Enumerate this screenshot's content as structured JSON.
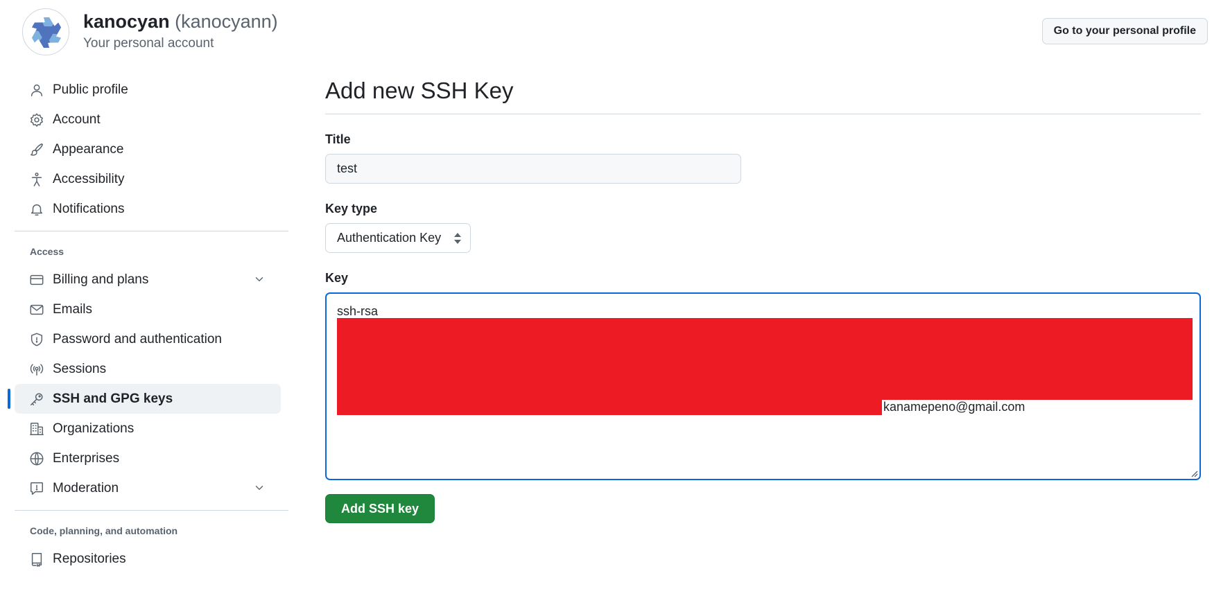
{
  "account": {
    "name": "kanocyan",
    "login": "(kanocyann)",
    "subtitle": "Your personal account",
    "profile_button": "Go to your personal profile"
  },
  "sidebar": {
    "top_items": [
      {
        "label": "Public profile",
        "icon": "person-icon"
      },
      {
        "label": "Account",
        "icon": "gear-icon"
      },
      {
        "label": "Appearance",
        "icon": "paintbrush-icon"
      },
      {
        "label": "Accessibility",
        "icon": "accessibility-icon"
      },
      {
        "label": "Notifications",
        "icon": "bell-icon"
      }
    ],
    "access_label": "Access",
    "access_items": [
      {
        "label": "Billing and plans",
        "icon": "credit-card-icon",
        "expandable": true
      },
      {
        "label": "Emails",
        "icon": "mail-icon"
      },
      {
        "label": "Password and authentication",
        "icon": "shield-icon"
      },
      {
        "label": "Sessions",
        "icon": "broadcast-icon"
      },
      {
        "label": "SSH and GPG keys",
        "icon": "key-icon",
        "active": true
      },
      {
        "label": "Organizations",
        "icon": "organization-icon"
      },
      {
        "label": "Enterprises",
        "icon": "globe-icon"
      },
      {
        "label": "Moderation",
        "icon": "report-icon",
        "expandable": true
      }
    ],
    "code_label": "Code, planning, and automation",
    "code_items": [
      {
        "label": "Repositories",
        "icon": "repo-icon"
      }
    ]
  },
  "main": {
    "title": "Add new SSH Key",
    "title_field_label": "Title",
    "title_value": "test",
    "key_type_label": "Key type",
    "key_type_value": "Authentication Key",
    "key_label": "Key",
    "key_prefix": "ssh-rsa",
    "key_email": "kanamepeno@gmail.com",
    "submit_label": "Add SSH key"
  },
  "colors": {
    "accent": "#0969da",
    "primary_button": "#1f883d",
    "redaction": "#ed1c24"
  }
}
